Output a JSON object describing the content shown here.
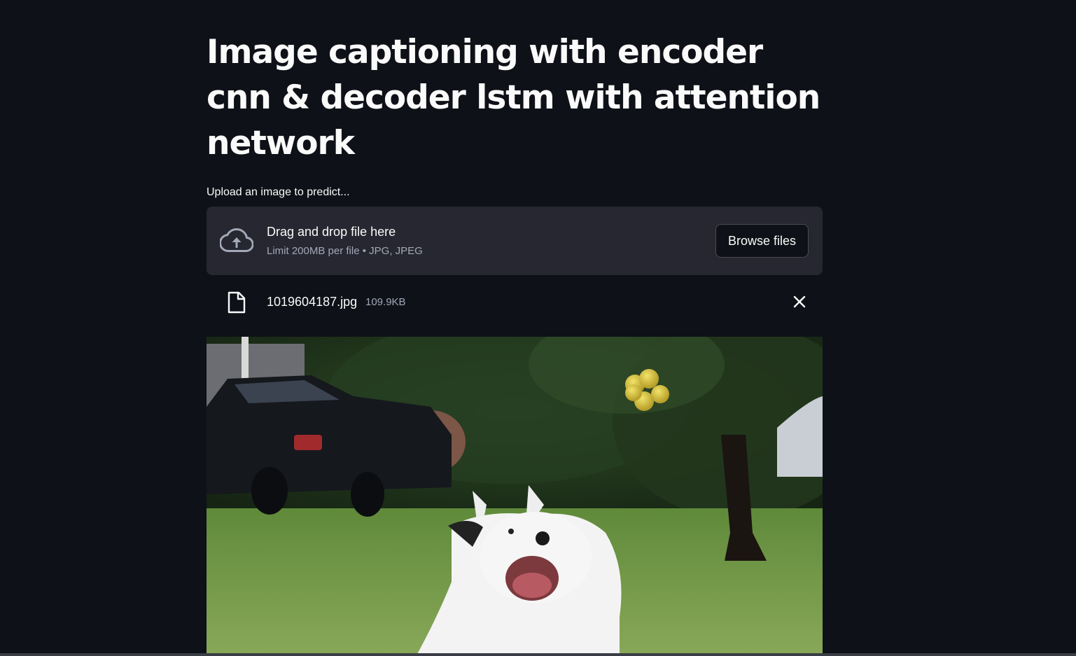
{
  "page": {
    "title": "Image captioning with encoder cnn & decoder lstm with attention network"
  },
  "uploader": {
    "label": "Upload an image to predict...",
    "dropzone_primary": "Drag and drop file here",
    "dropzone_secondary": "Limit 200MB per file • JPG, JPEG",
    "browse_label": "Browse files",
    "cloud_icon": "cloud-upload-icon"
  },
  "uploaded_file": {
    "name": "1019604187.jpg",
    "size": "109.9KB",
    "file_icon": "file-icon",
    "remove_icon": "close-icon"
  },
  "colors": {
    "background": "#0e1117",
    "dropzone": "#262730",
    "text": "#fafafa",
    "muted_text": "#a3a8b8"
  }
}
